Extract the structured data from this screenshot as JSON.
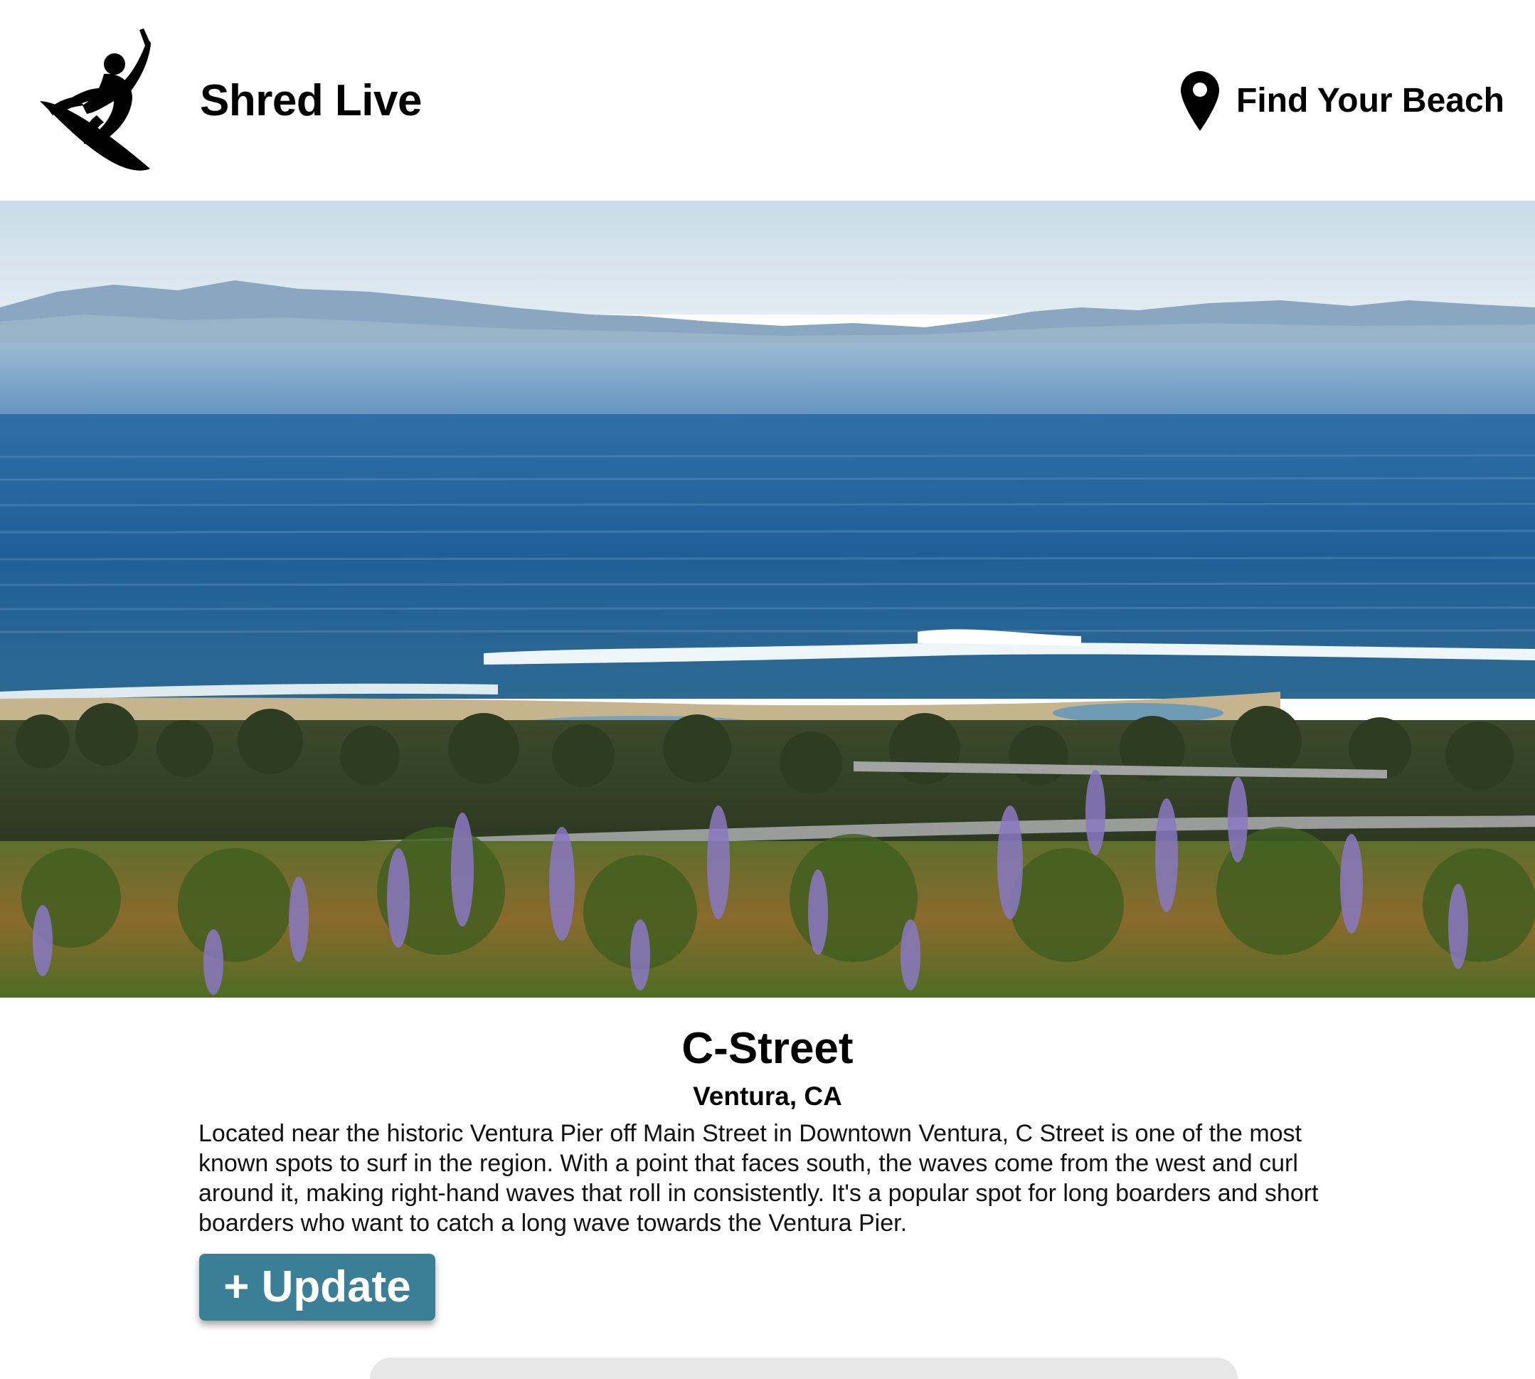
{
  "header": {
    "brand": "Shred Live",
    "logo_icon": "surfer-logo-icon",
    "nav": {
      "find_beach_label": "Find Your Beach",
      "icon": "map-pin-icon"
    }
  },
  "hero": {
    "image_alt": "C-Street surf break in Ventura with ocean swell, mountains and lavender in the foreground"
  },
  "beach": {
    "name": "C-Street",
    "location": "Ventura, CA",
    "description": "Located near the historic Ventura Pier off Main Street in Downtown Ventura, C Street is one of the most known spots to surf in the region. With a point that faces south, the waves come from the west and curl around it, making right-hand waves that roll in consistently. It's a popular spot for long boarders and short boarders who want to catch a long wave towards the Ventura Pier.",
    "update_label": "+ Update"
  },
  "colors": {
    "accent": "#3a7f96",
    "background": "#ffffff",
    "text": "#000000"
  }
}
